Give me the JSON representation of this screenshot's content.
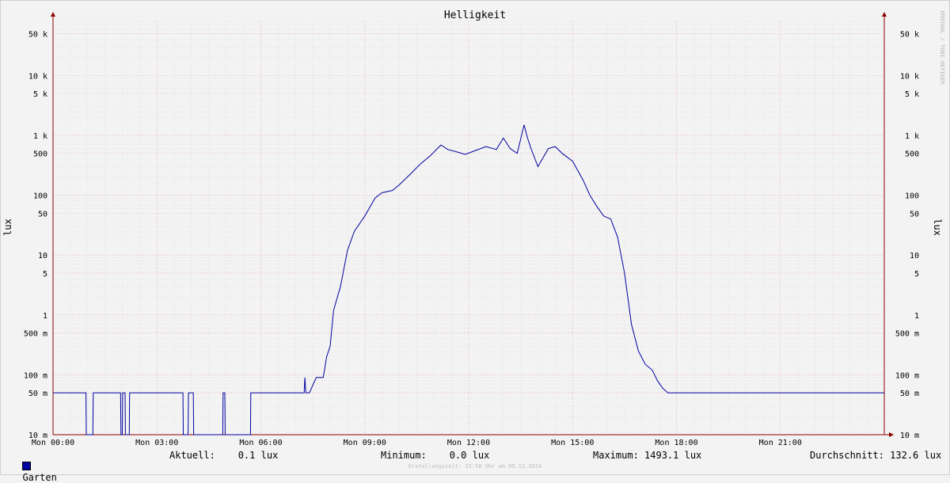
{
  "chart_data": {
    "type": "line",
    "title": "Helligkeit",
    "ylabel": "lux",
    "yscale": "log",
    "ylim": [
      0.01,
      80000
    ],
    "xlim": [
      0,
      24
    ],
    "x_ticks": [
      {
        "value": 0,
        "label": "Mon 00:00"
      },
      {
        "value": 3,
        "label": "Mon 03:00"
      },
      {
        "value": 6,
        "label": "Mon 06:00"
      },
      {
        "value": 9,
        "label": "Mon 09:00"
      },
      {
        "value": 12,
        "label": "Mon 12:00"
      },
      {
        "value": 15,
        "label": "Mon 15:00"
      },
      {
        "value": 18,
        "label": "Mon 18:00"
      },
      {
        "value": 21,
        "label": "Mon 21:00"
      }
    ],
    "y_ticks": [
      {
        "value": 0.01,
        "label": "10 m"
      },
      {
        "value": 0.05,
        "label": "50 m"
      },
      {
        "value": 0.1,
        "label": "100 m"
      },
      {
        "value": 0.5,
        "label": "500 m"
      },
      {
        "value": 1,
        "label": "1"
      },
      {
        "value": 5,
        "label": "5"
      },
      {
        "value": 10,
        "label": "10"
      },
      {
        "value": 50,
        "label": "50"
      },
      {
        "value": 100,
        "label": "100"
      },
      {
        "value": 500,
        "label": "500"
      },
      {
        "value": 1000,
        "label": "1 k"
      },
      {
        "value": 5000,
        "label": "5 k"
      },
      {
        "value": 10000,
        "label": "10 k"
      },
      {
        "value": 50000,
        "label": "50 k"
      }
    ],
    "grid": true,
    "series": [
      {
        "name": "Garten",
        "color": "#0000a0",
        "x": [
          0,
          0.95,
          0.96,
          1.15,
          1.16,
          1.95,
          1.96,
          2.0,
          2.01,
          2.08,
          2.09,
          2.2,
          2.21,
          3.75,
          3.76,
          3.9,
          3.91,
          4.05,
          4.06,
          4.9,
          4.91,
          4.96,
          4.97,
          5.7,
          5.71,
          7.25,
          7.27,
          7.3,
          7.4,
          7.6,
          7.8,
          7.9,
          8.0,
          8.1,
          8.3,
          8.5,
          8.7,
          9.0,
          9.3,
          9.5,
          9.8,
          10.0,
          10.3,
          10.6,
          10.9,
          11.2,
          11.4,
          11.7,
          11.9,
          12.2,
          12.5,
          12.8,
          13.0,
          13.2,
          13.4,
          13.6,
          13.7,
          13.8,
          14.0,
          14.3,
          14.5,
          14.7,
          15.0,
          15.3,
          15.5,
          15.7,
          15.9,
          16.1,
          16.3,
          16.5,
          16.7,
          16.9,
          17.1,
          17.3,
          17.45,
          17.6,
          17.75,
          17.9,
          17.95,
          18.0,
          21.0,
          24.0
        ],
        "y": [
          0.05,
          0.05,
          0.01,
          0.01,
          0.05,
          0.05,
          0.01,
          0.01,
          0.05,
          0.05,
          0.01,
          0.01,
          0.05,
          0.05,
          0.01,
          0.01,
          0.05,
          0.05,
          0.01,
          0.01,
          0.05,
          0.05,
          0.01,
          0.01,
          0.05,
          0.05,
          0.09,
          0.05,
          0.05,
          0.09,
          0.09,
          0.2,
          0.3,
          1.2,
          3,
          12,
          25,
          45,
          90,
          110,
          120,
          150,
          220,
          330,
          460,
          690,
          580,
          520,
          480,
          560,
          650,
          580,
          900,
          600,
          500,
          1493,
          900,
          600,
          300,
          600,
          650,
          500,
          370,
          180,
          100,
          65,
          45,
          40,
          20,
          5,
          0.7,
          0.25,
          0.15,
          0.12,
          0.08,
          0.06,
          0.05,
          0.05,
          0.05,
          0.05,
          0.05,
          0.05
        ]
      }
    ]
  },
  "legend": {
    "series_name": "Garten",
    "aktuell": "Aktuell:    0.1 lux",
    "minimum": "Minimum:    0.0 lux",
    "maximum": "Maximum: 1493.1 lux",
    "durchschnitt": "Durchschnitt: 132.6 lux"
  },
  "footer": "Erstellungszeit: 23:58 Uhr am 09.12.2024",
  "watermark": "RRDTOOL / TOBI OETIKER",
  "colors": {
    "line": "#0000a0",
    "grid_major": "#e8a0a0",
    "grid_minor": "#d8d8d8",
    "axis": "#8b0000"
  }
}
